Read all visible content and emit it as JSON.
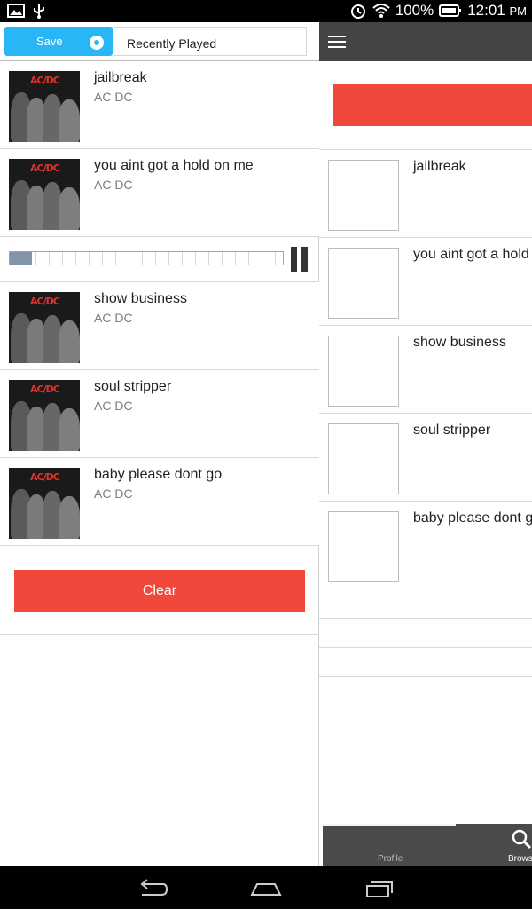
{
  "status_bar": {
    "battery": "100%",
    "time": "12:01",
    "ampm": "PM"
  },
  "left": {
    "save_label": "Save",
    "recent_label": "Recently Played",
    "songs_top": [
      {
        "title": "jailbreak",
        "artist": "AC DC"
      },
      {
        "title": "you aint got a hold on me",
        "artist": "AC DC"
      }
    ],
    "player": {
      "progress_fraction": 0.08
    },
    "songs_bottom": [
      {
        "title": "show business",
        "artist": "AC DC"
      },
      {
        "title": "soul stripper",
        "artist": "AC DC"
      },
      {
        "title": "baby please dont go",
        "artist": "AC DC"
      }
    ],
    "clear_label": "Clear",
    "album_logo": "AC/DC"
  },
  "right": {
    "items": [
      {
        "title": "jailbreak"
      },
      {
        "title": "you aint got a hold"
      },
      {
        "title": "show business"
      },
      {
        "title": "soul stripper"
      },
      {
        "title": "baby please dont g"
      }
    ],
    "tabs": {
      "profile": "Profile",
      "browse": "Brows"
    }
  },
  "colors": {
    "accent_blue": "#29b6f6",
    "clear_red": "#f0483a",
    "toolbar_dark": "#444444"
  }
}
